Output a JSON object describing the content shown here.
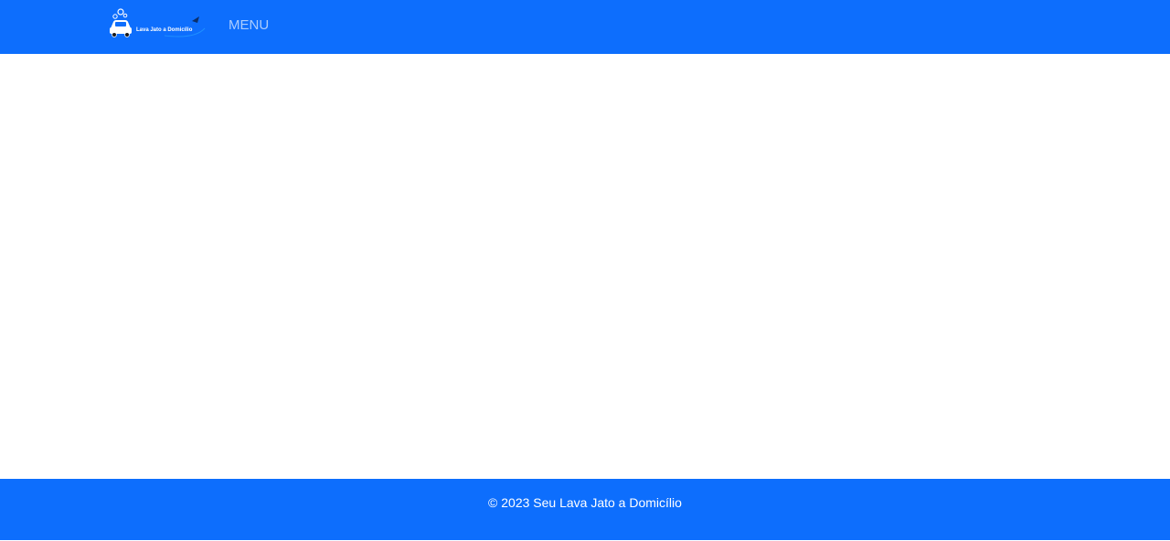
{
  "navbar": {
    "brand_logo_text": "Lava Jato a Domicílio",
    "menu_label": "MENU"
  },
  "footer": {
    "copyright": "© 2023 Seu Lava Jato a Domicílio"
  },
  "colors": {
    "primary": "#0d6efd",
    "background": "#ffffff",
    "menu_text": "rgba(255,255,255,0.65)",
    "footer_text": "#ffffff"
  }
}
